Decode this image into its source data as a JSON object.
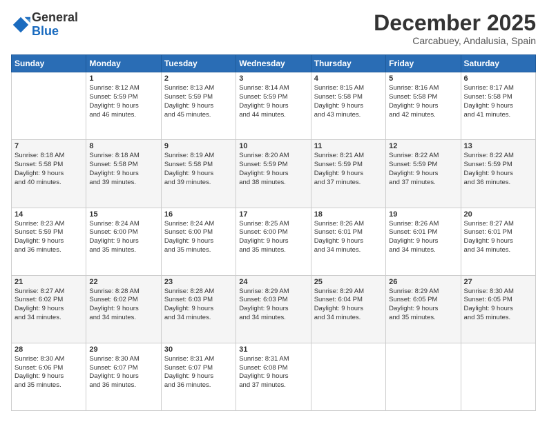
{
  "logo": {
    "text1": "General",
    "text2": "Blue"
  },
  "header": {
    "month": "December 2025",
    "location": "Carcabuey, Andalusia, Spain"
  },
  "weekdays": [
    "Sunday",
    "Monday",
    "Tuesday",
    "Wednesday",
    "Thursday",
    "Friday",
    "Saturday"
  ],
  "weeks": [
    [
      {
        "day": "",
        "info": ""
      },
      {
        "day": "1",
        "info": "Sunrise: 8:12 AM\nSunset: 5:59 PM\nDaylight: 9 hours\nand 46 minutes."
      },
      {
        "day": "2",
        "info": "Sunrise: 8:13 AM\nSunset: 5:59 PM\nDaylight: 9 hours\nand 45 minutes."
      },
      {
        "day": "3",
        "info": "Sunrise: 8:14 AM\nSunset: 5:59 PM\nDaylight: 9 hours\nand 44 minutes."
      },
      {
        "day": "4",
        "info": "Sunrise: 8:15 AM\nSunset: 5:58 PM\nDaylight: 9 hours\nand 43 minutes."
      },
      {
        "day": "5",
        "info": "Sunrise: 8:16 AM\nSunset: 5:58 PM\nDaylight: 9 hours\nand 42 minutes."
      },
      {
        "day": "6",
        "info": "Sunrise: 8:17 AM\nSunset: 5:58 PM\nDaylight: 9 hours\nand 41 minutes."
      }
    ],
    [
      {
        "day": "7",
        "info": "Sunrise: 8:18 AM\nSunset: 5:58 PM\nDaylight: 9 hours\nand 40 minutes."
      },
      {
        "day": "8",
        "info": "Sunrise: 8:18 AM\nSunset: 5:58 PM\nDaylight: 9 hours\nand 39 minutes."
      },
      {
        "day": "9",
        "info": "Sunrise: 8:19 AM\nSunset: 5:58 PM\nDaylight: 9 hours\nand 39 minutes."
      },
      {
        "day": "10",
        "info": "Sunrise: 8:20 AM\nSunset: 5:59 PM\nDaylight: 9 hours\nand 38 minutes."
      },
      {
        "day": "11",
        "info": "Sunrise: 8:21 AM\nSunset: 5:59 PM\nDaylight: 9 hours\nand 37 minutes."
      },
      {
        "day": "12",
        "info": "Sunrise: 8:22 AM\nSunset: 5:59 PM\nDaylight: 9 hours\nand 37 minutes."
      },
      {
        "day": "13",
        "info": "Sunrise: 8:22 AM\nSunset: 5:59 PM\nDaylight: 9 hours\nand 36 minutes."
      }
    ],
    [
      {
        "day": "14",
        "info": "Sunrise: 8:23 AM\nSunset: 5:59 PM\nDaylight: 9 hours\nand 36 minutes."
      },
      {
        "day": "15",
        "info": "Sunrise: 8:24 AM\nSunset: 6:00 PM\nDaylight: 9 hours\nand 35 minutes."
      },
      {
        "day": "16",
        "info": "Sunrise: 8:24 AM\nSunset: 6:00 PM\nDaylight: 9 hours\nand 35 minutes."
      },
      {
        "day": "17",
        "info": "Sunrise: 8:25 AM\nSunset: 6:00 PM\nDaylight: 9 hours\nand 35 minutes."
      },
      {
        "day": "18",
        "info": "Sunrise: 8:26 AM\nSunset: 6:01 PM\nDaylight: 9 hours\nand 34 minutes."
      },
      {
        "day": "19",
        "info": "Sunrise: 8:26 AM\nSunset: 6:01 PM\nDaylight: 9 hours\nand 34 minutes."
      },
      {
        "day": "20",
        "info": "Sunrise: 8:27 AM\nSunset: 6:01 PM\nDaylight: 9 hours\nand 34 minutes."
      }
    ],
    [
      {
        "day": "21",
        "info": "Sunrise: 8:27 AM\nSunset: 6:02 PM\nDaylight: 9 hours\nand 34 minutes."
      },
      {
        "day": "22",
        "info": "Sunrise: 8:28 AM\nSunset: 6:02 PM\nDaylight: 9 hours\nand 34 minutes."
      },
      {
        "day": "23",
        "info": "Sunrise: 8:28 AM\nSunset: 6:03 PM\nDaylight: 9 hours\nand 34 minutes."
      },
      {
        "day": "24",
        "info": "Sunrise: 8:29 AM\nSunset: 6:03 PM\nDaylight: 9 hours\nand 34 minutes."
      },
      {
        "day": "25",
        "info": "Sunrise: 8:29 AM\nSunset: 6:04 PM\nDaylight: 9 hours\nand 34 minutes."
      },
      {
        "day": "26",
        "info": "Sunrise: 8:29 AM\nSunset: 6:05 PM\nDaylight: 9 hours\nand 35 minutes."
      },
      {
        "day": "27",
        "info": "Sunrise: 8:30 AM\nSunset: 6:05 PM\nDaylight: 9 hours\nand 35 minutes."
      }
    ],
    [
      {
        "day": "28",
        "info": "Sunrise: 8:30 AM\nSunset: 6:06 PM\nDaylight: 9 hours\nand 35 minutes."
      },
      {
        "day": "29",
        "info": "Sunrise: 8:30 AM\nSunset: 6:07 PM\nDaylight: 9 hours\nand 36 minutes."
      },
      {
        "day": "30",
        "info": "Sunrise: 8:31 AM\nSunset: 6:07 PM\nDaylight: 9 hours\nand 36 minutes."
      },
      {
        "day": "31",
        "info": "Sunrise: 8:31 AM\nSunset: 6:08 PM\nDaylight: 9 hours\nand 37 minutes."
      },
      {
        "day": "",
        "info": ""
      },
      {
        "day": "",
        "info": ""
      },
      {
        "day": "",
        "info": ""
      }
    ]
  ]
}
